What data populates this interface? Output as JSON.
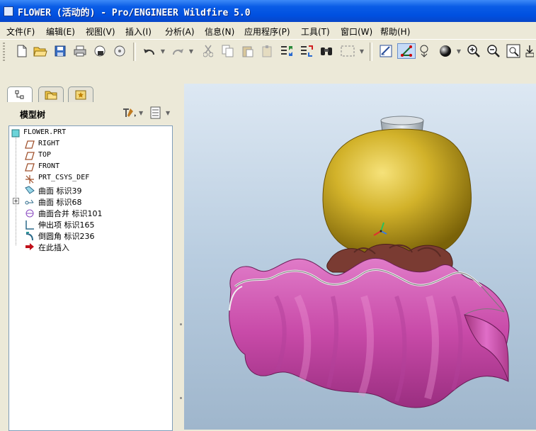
{
  "window": {
    "title": "FLOWER (活动的) - Pro/ENGINEER Wildfire 5.0"
  },
  "menu": [
    {
      "label": "文件(F)"
    },
    {
      "label": "编辑(E)"
    },
    {
      "label": "视图(V)"
    },
    {
      "label": "插入(I)"
    },
    {
      "label": "分析(A)"
    },
    {
      "label": "信息(N)"
    },
    {
      "label": "应用程序(P)"
    },
    {
      "label": "工具(T)"
    },
    {
      "label": "窗口(W)"
    },
    {
      "label": "帮助(H)"
    }
  ],
  "toolbar_icons": [
    "new-file-icon",
    "open-folder-icon",
    "save-icon",
    "print-icon",
    "send-mail-icon",
    "disk-icon",
    "undo-icon",
    "redo-icon",
    "cut-icon",
    "copy-icon",
    "paste-icon",
    "paste-special-icon",
    "regenerate-icon",
    "regen-manager-icon",
    "find-binoculars-icon",
    "select-box-icon",
    "datum-display-icon",
    "spin-center-icon",
    "saved-views-icon",
    "shading-icon",
    "zoom-in-icon",
    "zoom-out-icon",
    "refit-icon"
  ],
  "nav": {
    "tabs": [
      "model-tree-tab",
      "folder-browser-tab",
      "favorites-tab"
    ],
    "panel_title": "模型树"
  },
  "tree": {
    "items": [
      {
        "label": "FLOWER.PRT",
        "icon": "part-icon"
      },
      {
        "label": "RIGHT",
        "icon": "datum-plane-icon"
      },
      {
        "label": "TOP",
        "icon": "datum-plane-icon"
      },
      {
        "label": "FRONT",
        "icon": "datum-plane-icon"
      },
      {
        "label": "PRT_CSYS_DEF",
        "icon": "csys-icon"
      },
      {
        "label": "曲面 标识39",
        "icon": "surface-icon"
      },
      {
        "label": "曲面 标识68",
        "icon": "surface-icon"
      },
      {
        "label": "曲面合并 标识101",
        "icon": "merge-icon"
      },
      {
        "label": "伸出项 标识165",
        "icon": "protrusion-icon"
      },
      {
        "label": "倒圆角 标识236",
        "icon": "round-icon"
      },
      {
        "label": "在此插入",
        "icon": "insert-here-icon"
      }
    ]
  },
  "colors": {
    "title_bar": "#0a5ce6",
    "vase": "#c9a81e",
    "petals": "#c8459a",
    "inner": "#7a3b32",
    "background": "#b9cde0"
  }
}
